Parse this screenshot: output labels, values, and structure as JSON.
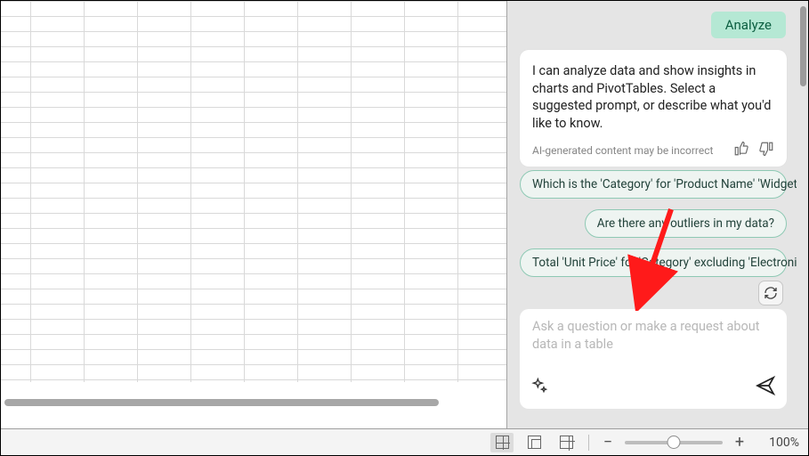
{
  "panel": {
    "tag": "Analyze",
    "intro": "I can analyze data and show insights in charts and PivotTables. Select a suggested prompt, or describe what you'd like to know.",
    "disclaimer": "AI-generated content may be incorrect",
    "suggestions": [
      "Which is the 'Category' for 'Product Name' 'Widget A'",
      "Are there any outliers in my data?",
      "Total 'Unit Price' for 'Category' excluding 'Electronics'"
    ],
    "input_placeholder": "Ask a question or make a request about data in a table"
  },
  "statusbar": {
    "zoom_label": "100%"
  }
}
